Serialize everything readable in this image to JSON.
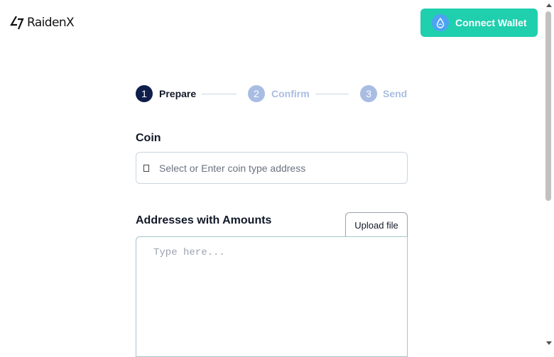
{
  "header": {
    "logo_text": "RaidenX",
    "connect_button_label": "Connect Wallet"
  },
  "steps": [
    {
      "number": "1",
      "label": "Prepare",
      "state": "active"
    },
    {
      "number": "2",
      "label": "Confirm",
      "state": "inactive"
    },
    {
      "number": "3",
      "label": "Send",
      "state": "inactive"
    }
  ],
  "form": {
    "coin_label": "Coin",
    "coin_placeholder": "Select or Enter coin type address",
    "coin_value": "",
    "addresses_label": "Addresses with Amounts",
    "upload_button_label": "Upload file",
    "addresses_placeholder": "Type here...",
    "addresses_value": ""
  },
  "colors": {
    "accent": "#1fcfae",
    "step_active": "#0f1e4a",
    "step_inactive": "#a9bde3",
    "step_inactive_text": "#a9bde3",
    "sui_badge": "#4ea1f3"
  },
  "icons": [
    "raidenx-logo-icon",
    "sui-droplet-icon",
    "coin-icon",
    "scroll-up-arrow",
    "scroll-down-arrow"
  ]
}
